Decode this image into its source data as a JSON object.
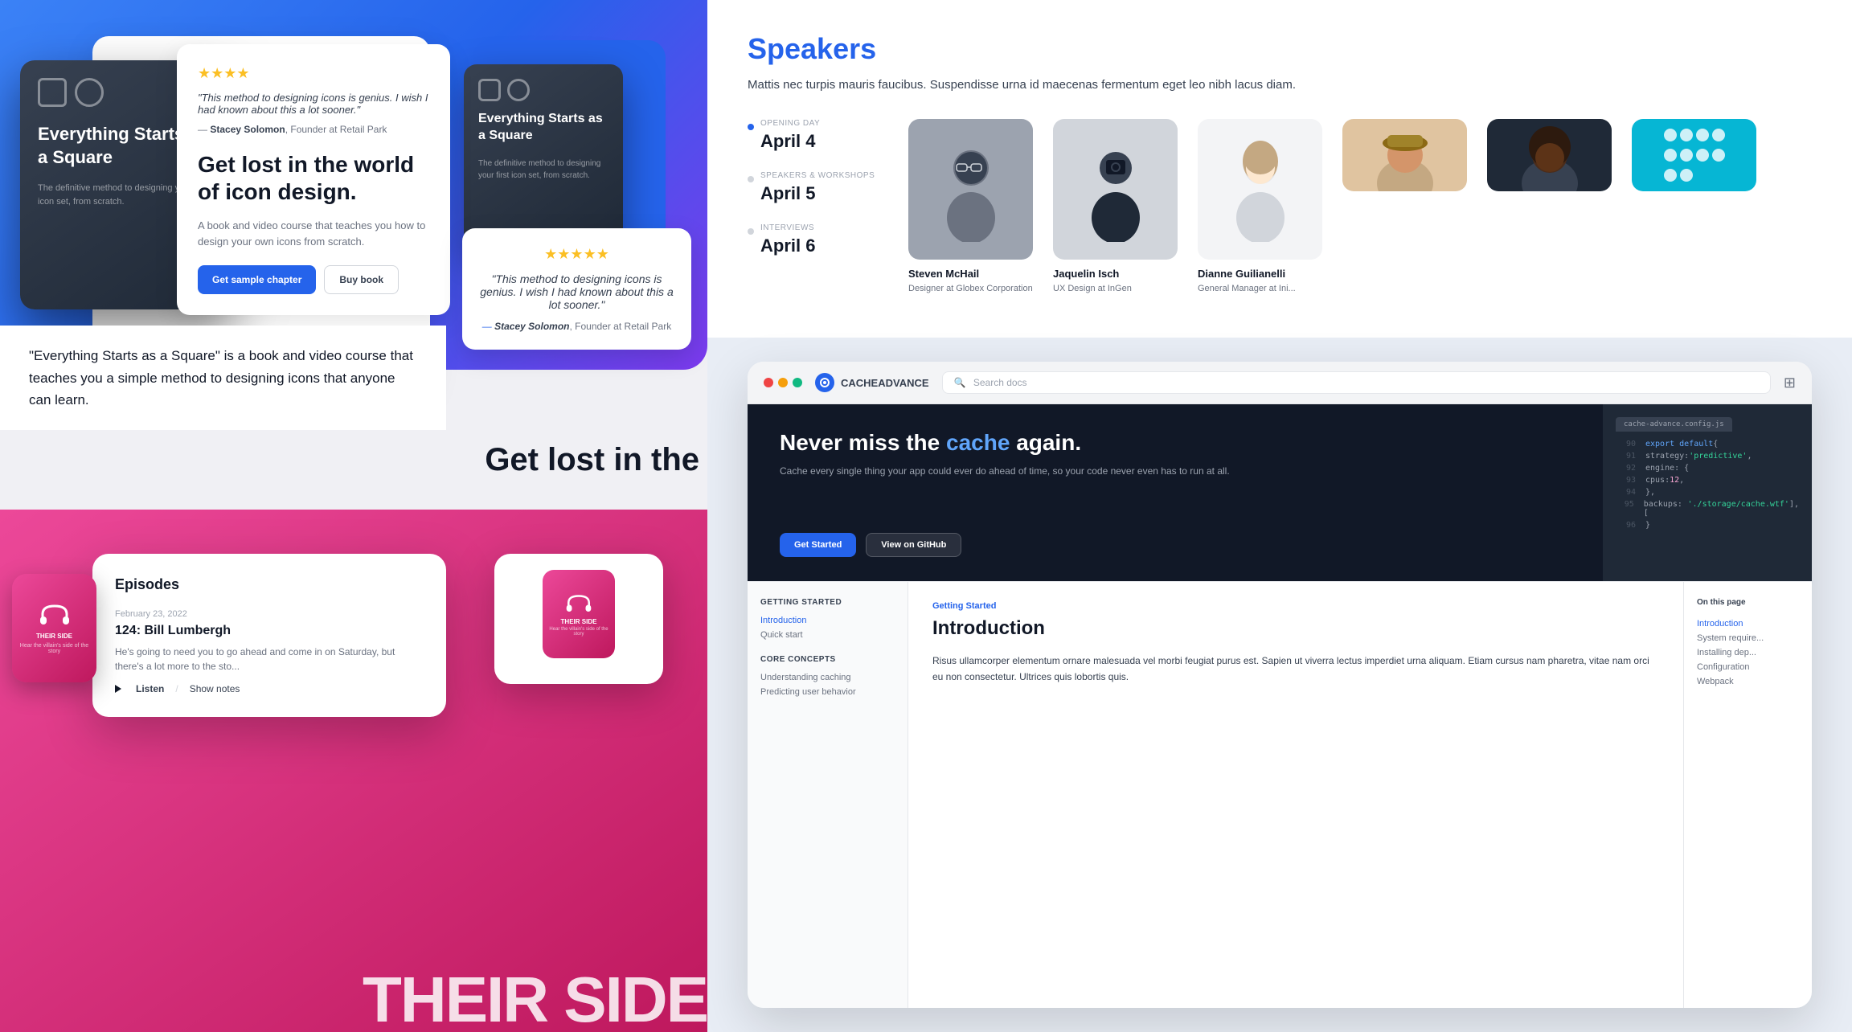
{
  "left": {
    "top": {
      "bg_color": "#2563eb",
      "book": {
        "title": "Everything Starts as a Square",
        "subtitle": "The definitive method to designing your first icon set, from scratch.",
        "headline": "Get lost in the world of icon design.",
        "description": "A book and video course that teaches you how to design your own icons from scratch.",
        "btn_sample": "Get sample chapter",
        "btn_buy": "Buy book"
      },
      "review": {
        "stars": "★★★★",
        "text": "\"This method to designing icons is genius. I wish I had known about this a lot sooner.\"",
        "reviewer_name": "Stacey Solomon",
        "reviewer_role": "Founder at Retail Park"
      },
      "review2": {
        "stars": "★★★★★",
        "text": "\"This method to designing icons is genius. I wish I had known about this a lot sooner.\"",
        "reviewer_name": "Stacey Solomon",
        "reviewer_role": "Founder at Retail Park"
      },
      "desc_section": {
        "text": "\"Everything Starts as a Square\" is a book and video course that teaches you a simple method to designing icons that anyone can learn."
      },
      "get_lost_partial": "Get lost in the"
    },
    "bottom": {
      "bg_color": "#ec4899",
      "podcast": {
        "name": "THEIR SIDE",
        "tagline": "Hear the villain's side of the story",
        "episodes_title": "Episodes",
        "episode": {
          "date": "February 23, 2022",
          "number": "124: Bill Lumbergh",
          "description": "He's going to need you to go ahead and come in on Saturday, but there's a lot more to the sto...",
          "listen_label": "Listen",
          "show_notes_label": "Show notes"
        }
      },
      "their_side_big": "theiR SIDE"
    }
  },
  "right": {
    "speakers": {
      "title": "Speakers",
      "description": "Mattis nec turpis mauris faucibus. Suspendisse urna id maecenas fermentum eget leo nibh lacus diam.",
      "schedule": [
        {
          "label": "Opening Day",
          "date": "April 4",
          "active": true
        },
        {
          "label": "Speakers & Workshops",
          "date": "April 5",
          "active": false
        },
        {
          "label": "Interviews",
          "date": "April 6",
          "active": false
        }
      ],
      "speakers_row1": [
        {
          "name": "Steven McHail",
          "role": "Designer at Globex Corporation",
          "color": "#6b7280"
        },
        {
          "name": "Jaquelin Isch",
          "role": "UX Design at InGen",
          "color": "#1f2937"
        },
        {
          "name": "Dianne Guilianelli",
          "role": "General Manager at Ini...",
          "color": "#d1d5db"
        }
      ]
    },
    "cacheadvance": {
      "logo": "CACHEADVANCE",
      "search_placeholder": "Search docs",
      "hero": {
        "headline_part1": "Never miss the",
        "headline_highlight": "cache",
        "headline_part2": "again.",
        "description": "Cache every single thing your app could ever do ahead of time, so your code never even has to run at all.",
        "btn_started": "Get Started",
        "btn_github": "View on GitHub"
      },
      "code": {
        "file": "cache-advance.config.js",
        "lines": [
          {
            "num": "90",
            "content": "export default {"
          },
          {
            "num": "91",
            "content": "  strategy: 'predictive',"
          },
          {
            "num": "92",
            "content": "  engine: {"
          },
          {
            "num": "93",
            "content": "    cpus: 12,"
          },
          {
            "num": "94",
            "content": "  },"
          },
          {
            "num": "95",
            "content": "  backups: ['./storage/cache.wtf'],"
          },
          {
            "num": "96",
            "content": "}"
          }
        ]
      },
      "docs": {
        "nav": {
          "getting_started_title": "Getting started",
          "items_gs": [
            "Introduction",
            "Quick start"
          ],
          "core_title": "Core concepts",
          "items_core": [
            "Understanding caching",
            "Predicting user behavior"
          ]
        },
        "on_page_title": "On this page",
        "on_page_items": [
          "Introduction",
          "System require...",
          "Installing dep...",
          "Configuration",
          "Webpack"
        ],
        "page_title": "Introduction",
        "getting_started_label": "Getting Started",
        "body": "Risus ullamcorper elementum ornare malesuada vel morbi feugiat purus est. Sapien ut viverra lectus imperdiet urna aliquam. Etiam cursus nam pharetra, vitae nam orci eu non consectetur. Ultrices quis lobortis quis."
      }
    }
  }
}
